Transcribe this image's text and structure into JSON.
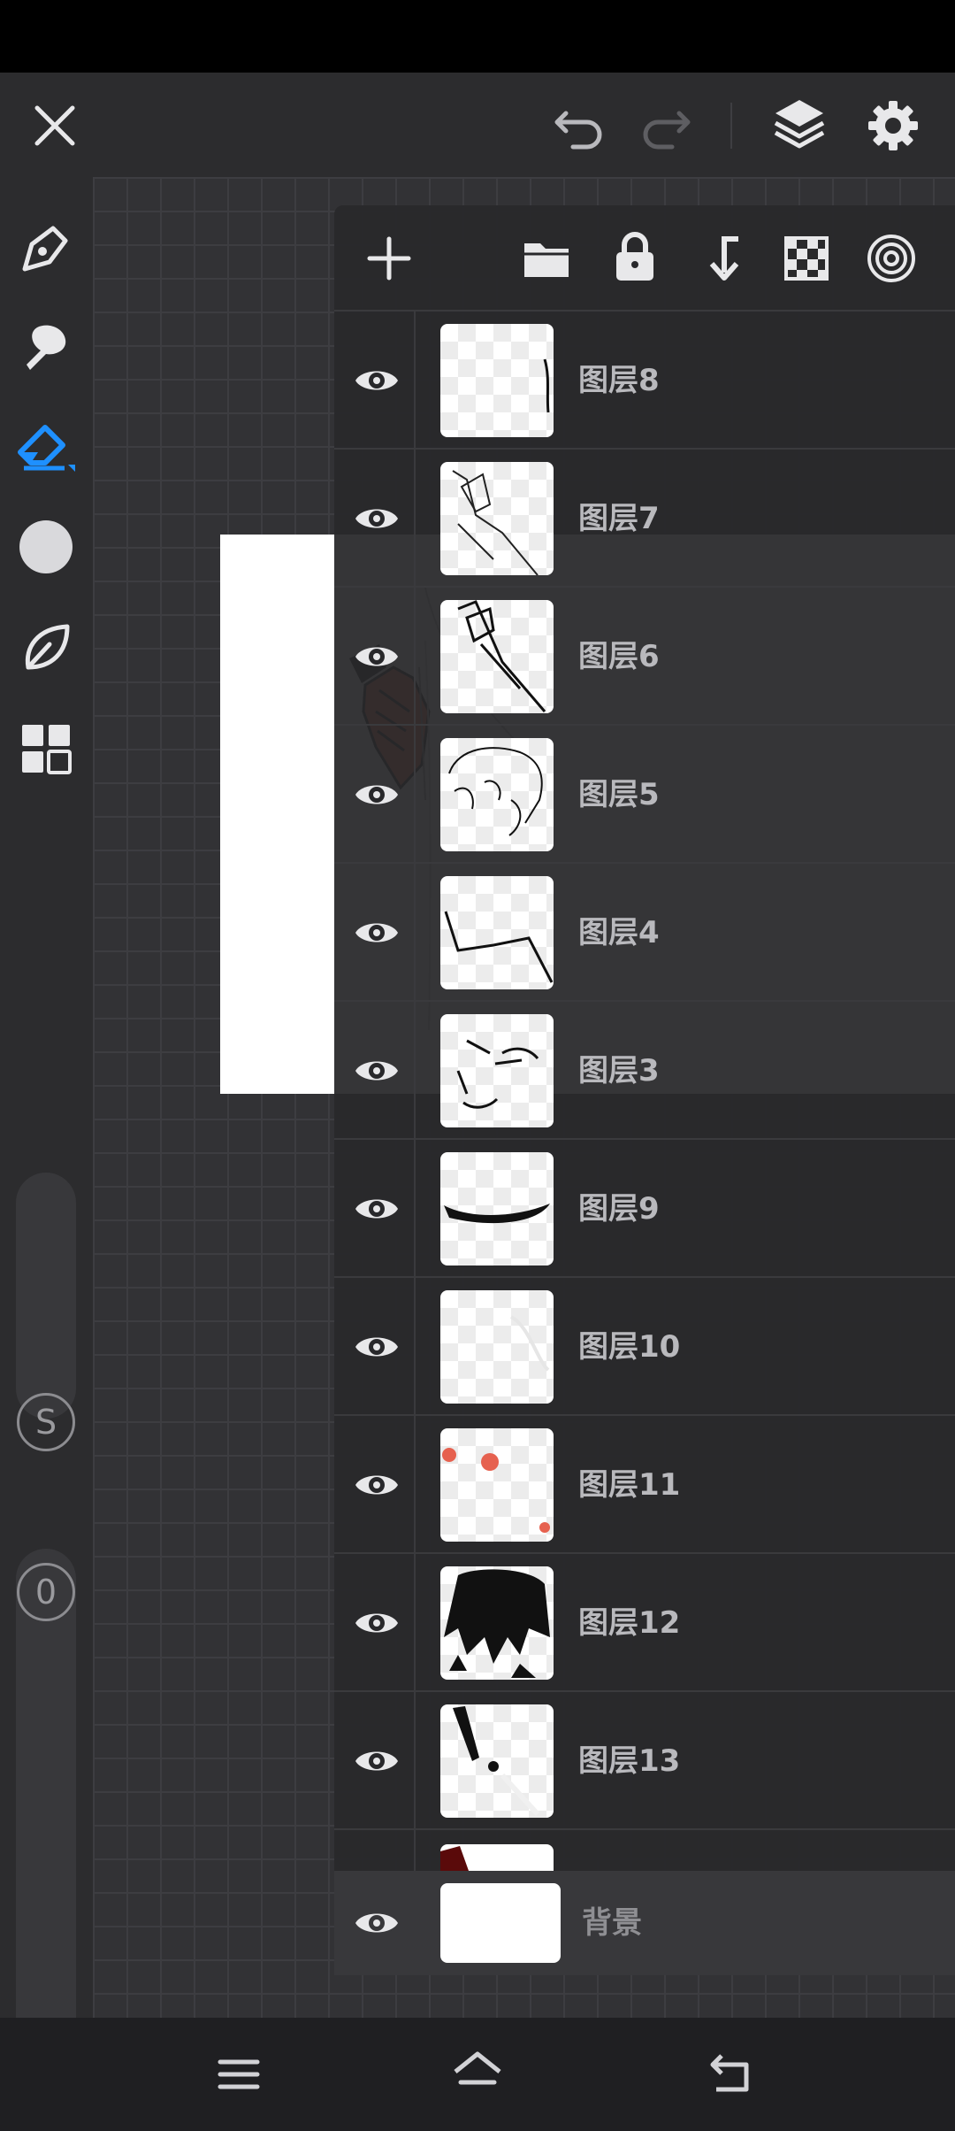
{
  "toolbar": {
    "close_icon": "close-icon",
    "undo_icon": "undo-icon",
    "redo_icon": "redo-icon",
    "layers_icon": "layers-icon",
    "settings_icon": "gear-icon"
  },
  "tools": [
    "pen-tool-icon",
    "smudge-tool-icon",
    "eraser-tool-icon",
    "color-picker-icon",
    "leaf-brush-icon",
    "grid-menu-icon"
  ],
  "left_controls": {
    "size_label": "S",
    "opacity_label": "0"
  },
  "layers_panel": {
    "header_actions": [
      "add-layer-icon",
      "folder-icon",
      "lock-icon",
      "merge-down-icon",
      "transparency-icon",
      "target-icon"
    ],
    "layers": [
      {
        "name": "图层8"
      },
      {
        "name": "图层7"
      },
      {
        "name": "图层6"
      },
      {
        "name": "图层5"
      },
      {
        "name": "图层4"
      },
      {
        "name": "图层3"
      },
      {
        "name": "图层9"
      },
      {
        "name": "图层10"
      },
      {
        "name": "图层11"
      },
      {
        "name": "图层12"
      },
      {
        "name": "图层13"
      }
    ],
    "background_layer": {
      "name": "背景"
    }
  },
  "colors": {
    "accent": "#1e90ff",
    "panel_bg": "#28282b",
    "layer_text": "#b9b9bd"
  }
}
